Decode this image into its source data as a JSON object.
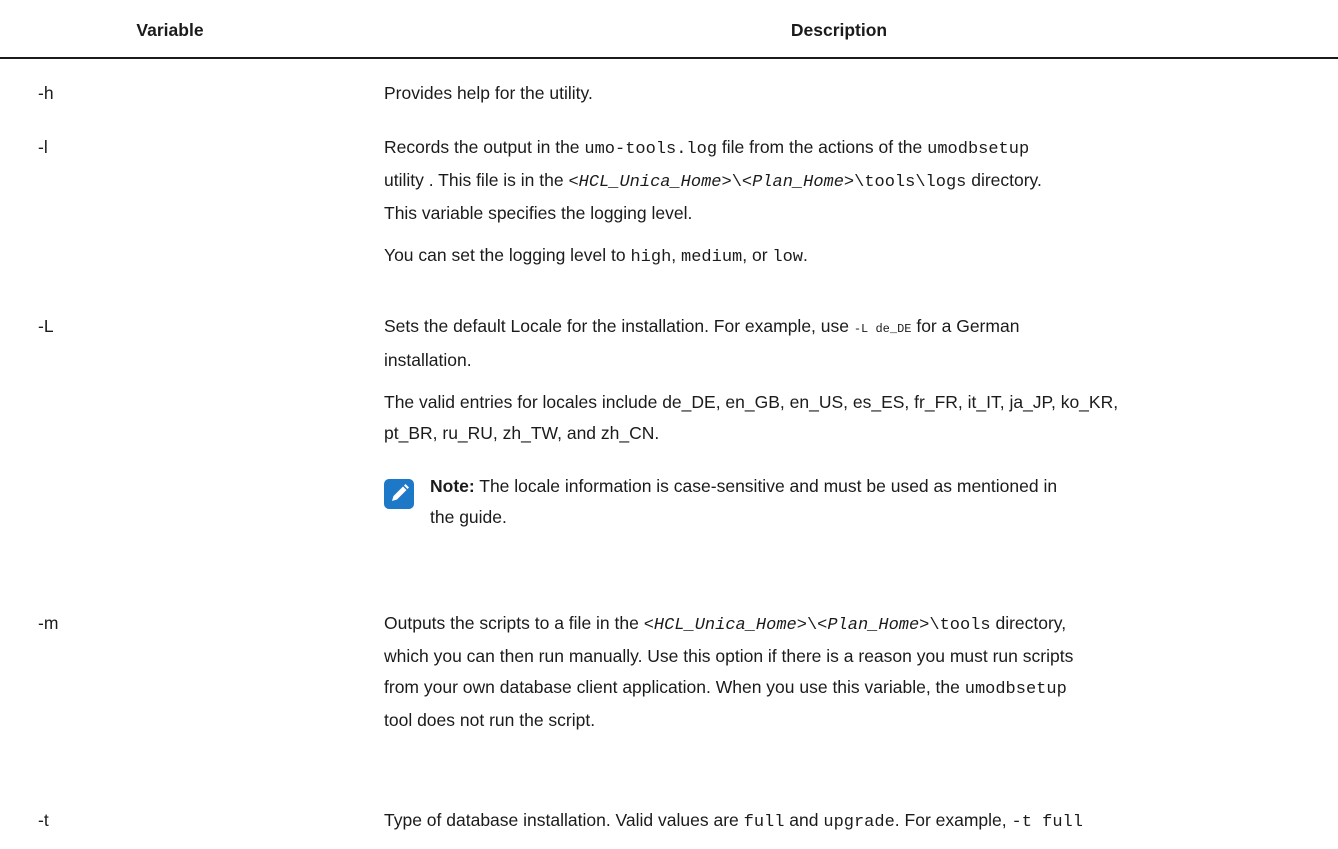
{
  "table": {
    "headers": {
      "variable": "Variable",
      "description": "Description"
    },
    "rows": [
      {
        "variable": "-h",
        "desc": "Provides help for the utility."
      },
      {
        "variable": "-l",
        "p1": {
          "a": "Records the output in the ",
          "code1": "umo-tools.log",
          "b": " file from the actions of the ",
          "code2": "umodbsetup",
          "c": "utility . This file is in the ",
          "path1": "<HCL_Unica_Home>",
          "sep1": "\\",
          "path2": "<Plan_Home>",
          "path3": "\\tools\\logs",
          "d": " directory.",
          "e": "This variable specifies the logging level."
        },
        "p2": {
          "a": "You can set the logging level to ",
          "v1": "high",
          "b": ", ",
          "v2": "medium",
          "c": ", or ",
          "v3": "low",
          "d": "."
        }
      },
      {
        "variable": "-L",
        "p1": {
          "a": "Sets the default Locale for the installation. For example, use ",
          "code": "-L de_DE",
          "b": " for a German",
          "c": "installation."
        },
        "p2": {
          "line1": "The valid entries for locales include de_DE, en_GB, en_US, es_ES, fr_FR, it_IT, ja_JP, ko_KR,",
          "line2": "pt_BR, ru_RU, zh_TW, and zh_CN."
        },
        "note": {
          "icon": "pencil-icon",
          "icon_color": "#1e78c8",
          "label": "Note:",
          "text1": " The locale information is case-sensitive and must be used as mentioned in",
          "text2": "the guide."
        }
      },
      {
        "variable": "-m",
        "p1": {
          "a": "Outputs the scripts to a file in the ",
          "path1": "<HCL_Unica_Home>",
          "sep1": "\\",
          "path2": "<Plan_Home>",
          "path3": "\\tools",
          "b": " directory,",
          "line2": "which you can then run manually. Use this option if there is a reason you must run scripts",
          "line3a": "from your own database client application. When you use this variable, the ",
          "code": "umodbsetup",
          "line4": "tool does not run the script."
        }
      },
      {
        "variable": "-t",
        "p1": {
          "a": "Type of database installation. Valid values are ",
          "v1": "full",
          "b": " and ",
          "v2": "upgrade",
          "c": ". For example, ",
          "code": "-t full"
        }
      }
    ]
  }
}
